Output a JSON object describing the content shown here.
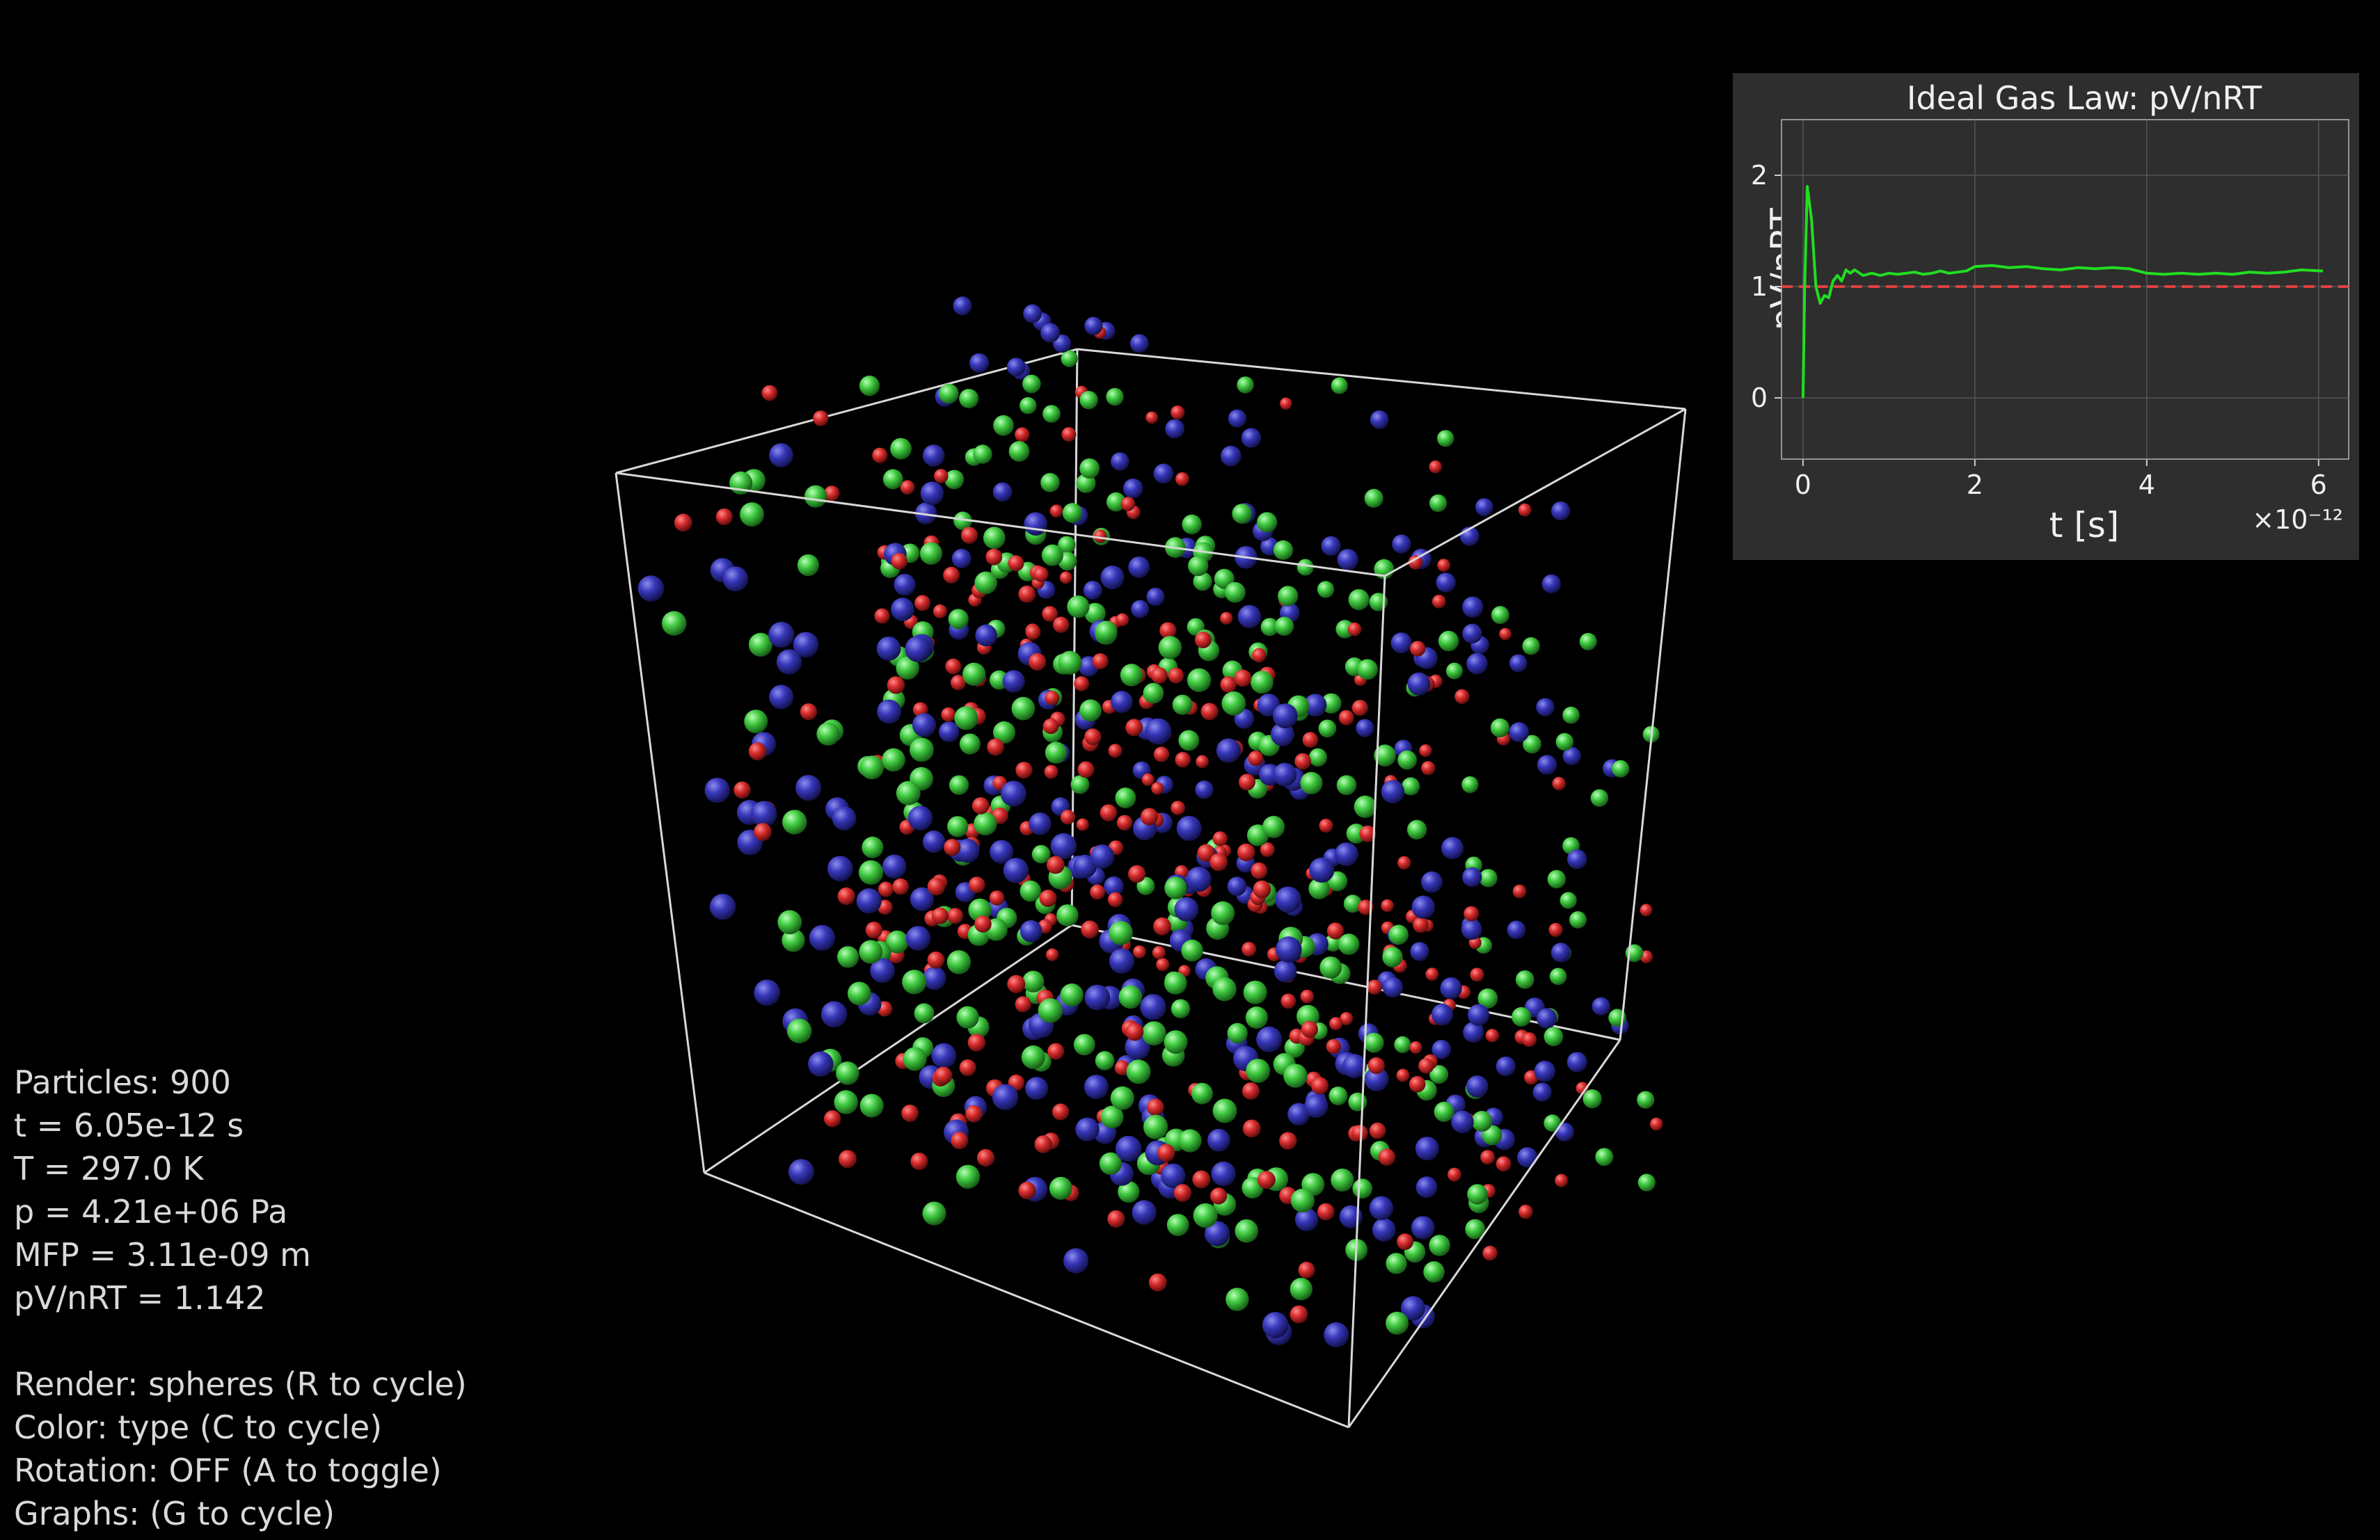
{
  "hud": {
    "particles": "Particles: 900",
    "time": "t = 6.05e-12 s",
    "temperature": "T = 297.0 K",
    "pressure": "p = 4.21e+06 Pa",
    "mfp": "MFP = 3.11e-09 m",
    "ratio": "pV/nRT = 1.142",
    "render": "Render: spheres (R to cycle)",
    "color": "Color: type (C to cycle)",
    "rotation": "Rotation: OFF (A to toggle)",
    "graphs": "Graphs: (G to cycle)"
  },
  "scene": {
    "particle_count": 900,
    "particle_types": [
      {
        "name": "red",
        "color": "#d02a2a"
      },
      {
        "name": "green",
        "color": "#3ec43e"
      },
      {
        "name": "blue",
        "color": "#3434b8"
      }
    ],
    "box_color": "#d8d8d8"
  },
  "chart_data": {
    "type": "line",
    "title": "Ideal Gas Law: pV/nRT",
    "xlabel": "t [s]",
    "ylabel": "pV/nRT",
    "x_multiplier": "×10⁻¹²",
    "xlim": [
      -0.25,
      6.35
    ],
    "ylim": [
      -0.55,
      2.5
    ],
    "x_ticks": [
      0,
      2,
      4,
      6
    ],
    "y_ticks": [
      0,
      1,
      2
    ],
    "grid": true,
    "reference_line": {
      "y": 1.0,
      "color": "#e04040",
      "style": "dashed"
    },
    "series": [
      {
        "color": "#22dd22",
        "x": [
          0.0,
          0.02,
          0.05,
          0.1,
          0.15,
          0.2,
          0.25,
          0.3,
          0.35,
          0.4,
          0.45,
          0.5,
          0.55,
          0.6,
          0.7,
          0.8,
          0.9,
          1.0,
          1.1,
          1.2,
          1.3,
          1.4,
          1.5,
          1.6,
          1.7,
          1.8,
          1.9,
          2.0,
          2.2,
          2.4,
          2.6,
          2.8,
          3.0,
          3.2,
          3.4,
          3.6,
          3.8,
          4.0,
          4.2,
          4.4,
          4.6,
          4.8,
          5.0,
          5.2,
          5.4,
          5.6,
          5.8,
          6.05
        ],
        "y": [
          0.0,
          1.0,
          1.9,
          1.6,
          1.0,
          0.85,
          0.92,
          0.9,
          1.05,
          1.1,
          1.05,
          1.15,
          1.12,
          1.15,
          1.1,
          1.12,
          1.1,
          1.12,
          1.11,
          1.12,
          1.13,
          1.11,
          1.12,
          1.14,
          1.12,
          1.13,
          1.14,
          1.18,
          1.19,
          1.17,
          1.18,
          1.16,
          1.15,
          1.17,
          1.16,
          1.17,
          1.16,
          1.12,
          1.11,
          1.12,
          1.11,
          1.12,
          1.11,
          1.13,
          1.12,
          1.13,
          1.15,
          1.14
        ]
      }
    ]
  }
}
